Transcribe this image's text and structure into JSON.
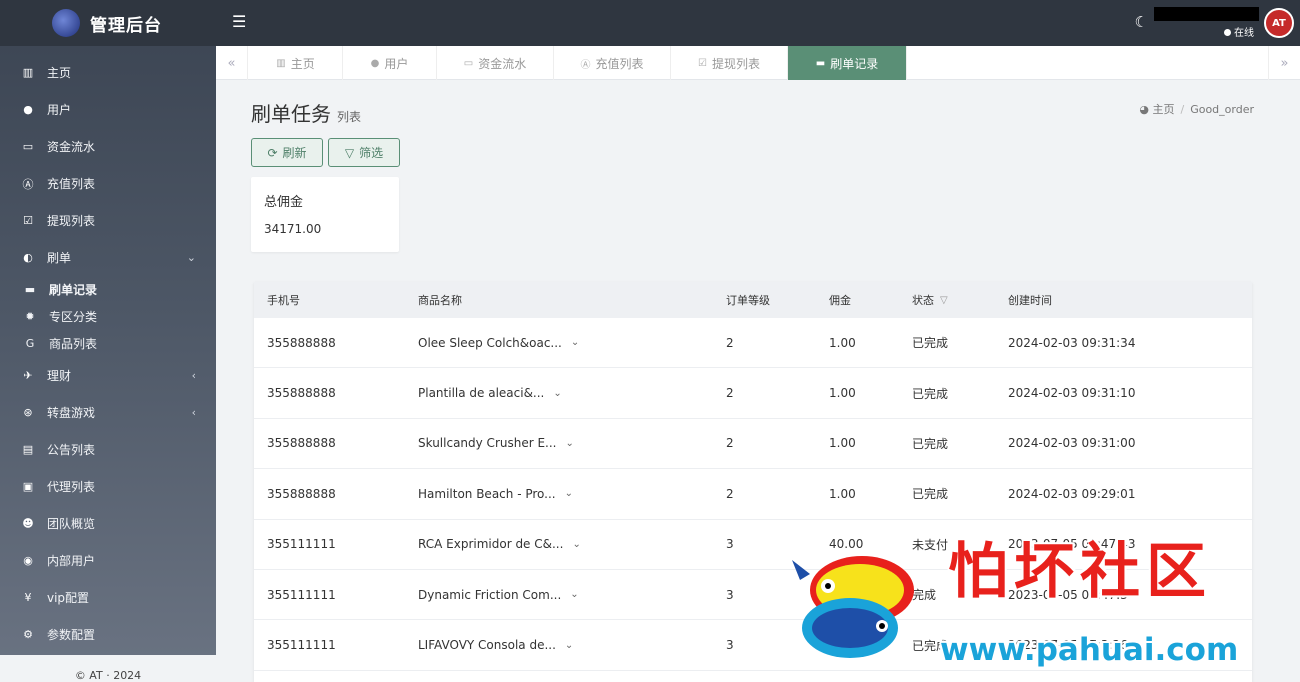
{
  "app": {
    "title": "管理后台"
  },
  "header": {
    "online_label": "在线",
    "avatar_text": "AT"
  },
  "sidebar": {
    "items": [
      {
        "label": "主页",
        "icon": "bar-chart-icon"
      },
      {
        "label": "用户",
        "icon": "user-icon"
      },
      {
        "label": "资金流水",
        "icon": "money-icon"
      },
      {
        "label": "充值列表",
        "icon": "font-icon"
      },
      {
        "label": "提现列表",
        "icon": "check-square-icon"
      },
      {
        "label": "刷单",
        "icon": "adjust-icon",
        "expanded": true,
        "children": [
          {
            "label": "刷单记录",
            "icon": "card-icon",
            "active": true
          },
          {
            "label": "专区分类",
            "icon": "cog-small-icon"
          },
          {
            "label": "商品列表",
            "icon": "google-icon"
          }
        ]
      },
      {
        "label": "理财",
        "icon": "plane-icon"
      },
      {
        "label": "转盘游戏",
        "icon": "gamepad-icon"
      },
      {
        "label": "公告列表",
        "icon": "file-icon"
      },
      {
        "label": "代理列表",
        "icon": "address-book-icon"
      },
      {
        "label": "团队概览",
        "icon": "users-icon"
      },
      {
        "label": "内部用户",
        "icon": "user-circle-icon"
      },
      {
        "label": "vip配置",
        "icon": "yen-icon"
      },
      {
        "label": "参数配置",
        "icon": "cogs-icon"
      }
    ],
    "footer": "© AT · 2024"
  },
  "tabs": [
    {
      "label": "主页",
      "icon": "bar-chart-icon",
      "active": false
    },
    {
      "label": "用户",
      "icon": "user-icon",
      "active": false
    },
    {
      "label": "资金流水",
      "icon": "money-icon",
      "active": false
    },
    {
      "label": "充值列表",
      "icon": "font-icon",
      "active": false
    },
    {
      "label": "提现列表",
      "icon": "check-square-icon",
      "active": false
    },
    {
      "label": "刷单记录",
      "icon": "card-icon",
      "active": true
    }
  ],
  "page": {
    "title": "刷单任务",
    "subtitle": "列表",
    "breadcrumb": {
      "home": "主页",
      "current": "Good_order"
    },
    "buttons": {
      "refresh": "刷新",
      "filter": "筛选"
    },
    "stat": {
      "label": "总佣金",
      "value": "34171.00"
    }
  },
  "table": {
    "headers": {
      "phone": "手机号",
      "name": "商品名称",
      "level": "订单等级",
      "commission": "佣金",
      "status": "状态",
      "time": "创建时间"
    },
    "rows": [
      {
        "phone": "355888888",
        "name": "Olee Sleep Colch&oac...",
        "level": "2",
        "commission": "1.00",
        "status": "已完成",
        "time": "2024-02-03 09:31:34"
      },
      {
        "phone": "355888888",
        "name": "Plantilla de aleaci&...",
        "level": "2",
        "commission": "1.00",
        "status": "已完成",
        "time": "2024-02-03 09:31:10"
      },
      {
        "phone": "355888888",
        "name": "Skullcandy Crusher E...",
        "level": "2",
        "commission": "1.00",
        "status": "已完成",
        "time": "2024-02-03 09:31:00"
      },
      {
        "phone": "355888888",
        "name": "Hamilton Beach - Pro...",
        "level": "2",
        "commission": "1.00",
        "status": "已完成",
        "time": "2024-02-03 09:29:01"
      },
      {
        "phone": "355111111",
        "name": "RCA Exprimidor de C&...",
        "level": "3",
        "commission": "40.00",
        "status": "未支付",
        "time": "2023-07-05 07:47:43"
      },
      {
        "phone": "355111111",
        "name": "Dynamic Friction Com...",
        "level": "3",
        "commission": "",
        "status": "完成",
        "time": "2023-07-05 07:47:3"
      },
      {
        "phone": "355111111",
        "name": "LIFAVOVY Consola de...",
        "level": "3",
        "commission": "",
        "status": "已完成",
        "time": "2023-07-05 07:3:26"
      }
    ]
  },
  "watermark": {
    "text": "怕坏社区",
    "url": "www.pahuai.com"
  },
  "colors": {
    "accent": "#5a8f76",
    "sidebar_dark": "#2f3640",
    "watermark_red": "#e8211c",
    "watermark_blue": "#1aa3d9"
  }
}
